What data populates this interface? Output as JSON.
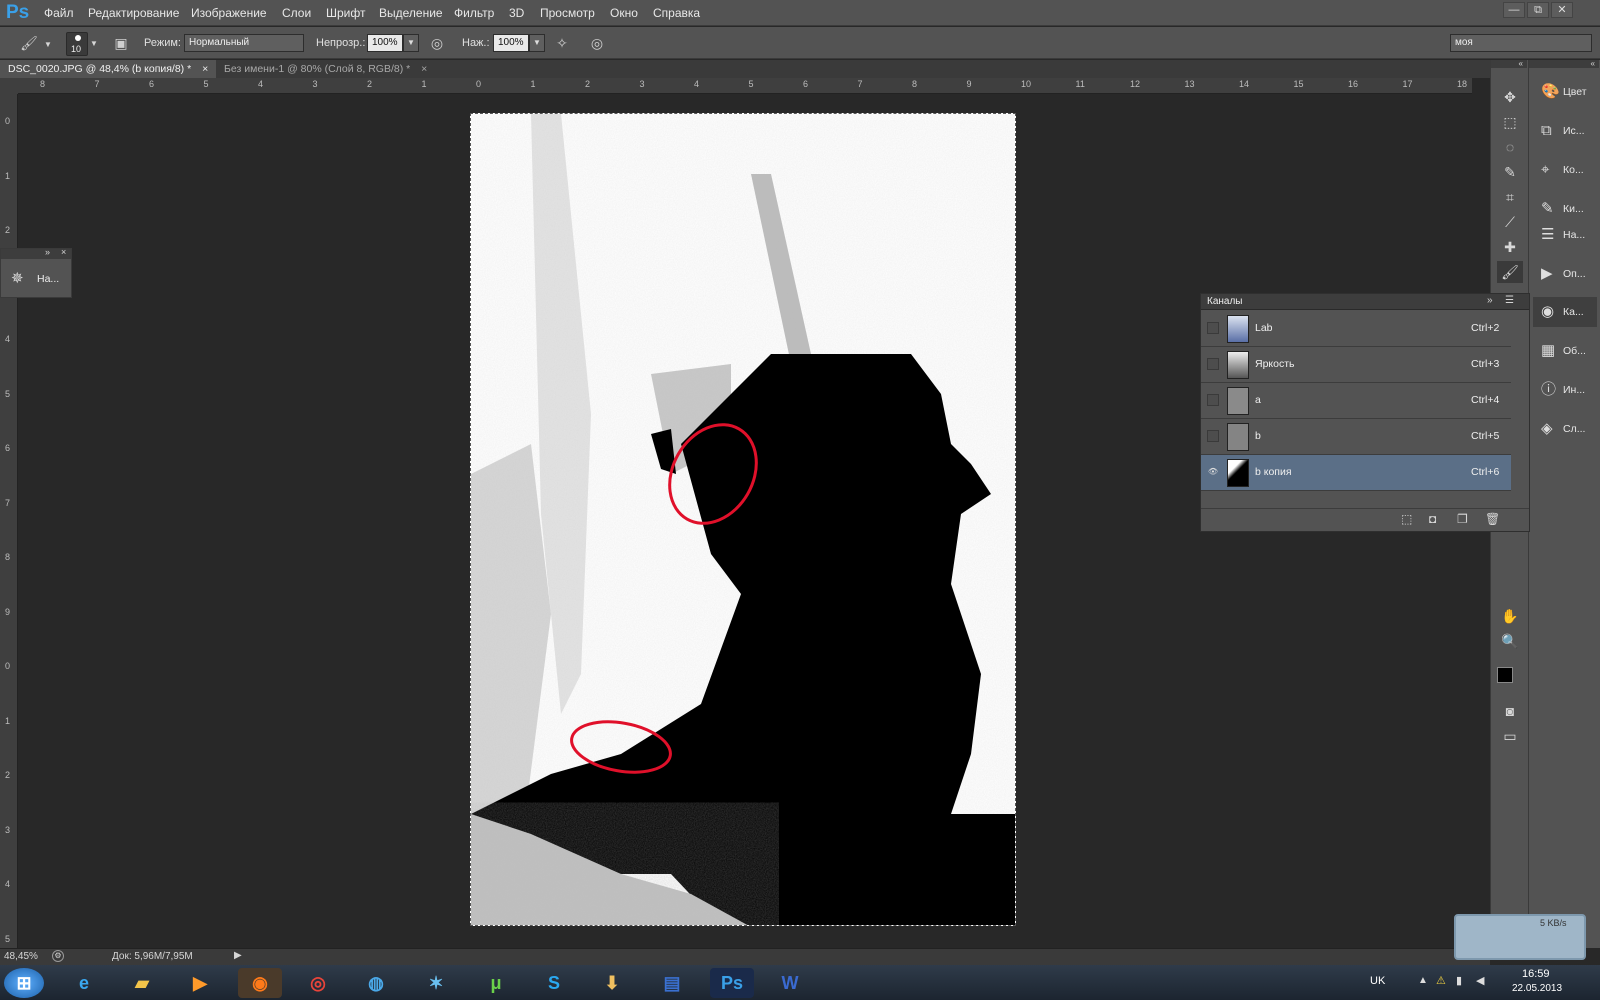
{
  "app": {
    "logo": "Ps"
  },
  "menu": [
    "Файл",
    "Редактирование",
    "Изображение",
    "Слои",
    "Шрифт",
    "Выделение",
    "Фильтр",
    "3D",
    "Просмотр",
    "Окно",
    "Справка"
  ],
  "window_controls": [
    "—",
    "⧉",
    "✕"
  ],
  "options": {
    "brush_size": "10",
    "mode_label": "Режим:",
    "mode_value": "Нормальный",
    "opacity_label": "Непрозр.:",
    "opacity_value": "100%",
    "pressure_label": "Наж.:",
    "pressure_value": "100%",
    "workspace": "моя"
  },
  "tabs": [
    {
      "label": "DSC_0020.JPG @ 48,4% (b копия/8) *",
      "close": "×"
    },
    {
      "label": "Без имени-1 @ 80% (Слой 8, RGB/8) *",
      "close": "×"
    }
  ],
  "ruler_h": [
    "8",
    "7",
    "6",
    "5",
    "4",
    "3",
    "2",
    "1",
    "0",
    "1",
    "2",
    "3",
    "4",
    "5",
    "6",
    "7",
    "8",
    "9",
    "10",
    "11",
    "12",
    "13",
    "14",
    "15",
    "16",
    "17",
    "18"
  ],
  "ruler_v": [
    "0",
    "1",
    "2",
    "3",
    "4",
    "5",
    "6",
    "7",
    "8",
    "9",
    "0",
    "1",
    "2",
    "3",
    "4",
    "5"
  ],
  "status": {
    "zoom": "48,45%",
    "doc": "Док: 5,96M/7,95M"
  },
  "nav_panel": {
    "label": "На..."
  },
  "channels": {
    "title": "Каналы",
    "rows": [
      {
        "name": "Lab",
        "shortcut": "Ctrl+2",
        "visible": false
      },
      {
        "name": "Яркость",
        "shortcut": "Ctrl+3",
        "visible": false
      },
      {
        "name": "a",
        "shortcut": "Ctrl+4",
        "visible": false
      },
      {
        "name": "b",
        "shortcut": "Ctrl+5",
        "visible": false
      },
      {
        "name": "b копия",
        "shortcut": "Ctrl+6",
        "visible": true,
        "eye": "👁"
      }
    ]
  },
  "dock": [
    {
      "label": "Цвет",
      "icon": "palette-icon"
    },
    {
      "label": "Ис...",
      "icon": "history-icon"
    },
    {
      "label": "Ко...",
      "icon": "actions-icon"
    },
    {
      "label": "Ки...",
      "icon": "brush-icon"
    },
    {
      "label": "На...",
      "icon": "adjust-icon"
    },
    {
      "label": "Оп...",
      "icon": "play-icon"
    },
    {
      "label": "Ка...",
      "icon": "channels-icon"
    },
    {
      "label": "Об...",
      "icon": "grid-icon"
    },
    {
      "label": "Ин...",
      "icon": "info-icon"
    },
    {
      "label": "Сл...",
      "icon": "layers-icon"
    }
  ],
  "taskbar": {
    "lang": "UK",
    "time": "16:59",
    "date": "22.05.2013",
    "net_speed": "5 KB/s",
    "apps": [
      "windows-start",
      "internet-explorer",
      "explorer",
      "media-player",
      "firefox",
      "chrome",
      "app-blue",
      "app-x",
      "utorrent",
      "skype",
      "downloads",
      "save",
      "photoshop",
      "word"
    ]
  },
  "colors": {
    "accent": "#3aa0e8",
    "selection": "#5b6f87",
    "annotation": "#e0102a"
  }
}
